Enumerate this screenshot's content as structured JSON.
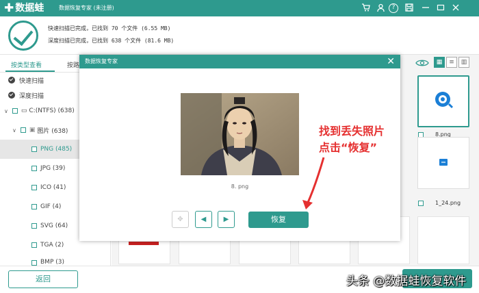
{
  "app": {
    "logo_mark": "✚",
    "name": "数据蛙",
    "subtitle": "数据恢复专家 (未注册)"
  },
  "titlebar_icons": [
    "cart-icon",
    "user-icon",
    "help-icon",
    "save-icon",
    "minimize-icon",
    "restore-icon",
    "close-icon"
  ],
  "status": {
    "quick": "快速扫描已完成，已找到 70 个文件 (6.55 MB)",
    "deep": "深度扫描已完成，已找到 638 个文件 (81.6 MB)"
  },
  "tabs": {
    "by_type": "按类型查看",
    "by_path": "按路"
  },
  "scan": {
    "quick": "快速扫描",
    "deep": "深度扫描"
  },
  "tree": {
    "drive": "C:(NTFS) (638)",
    "pictures": "图片 (638)",
    "items": [
      "PNG (485)",
      "JPG (39)",
      "ICO (41)",
      "GIF (4)",
      "SVG (64)",
      "TGA (2)",
      "BMP (3)"
    ]
  },
  "files": {
    "f1": "8.png",
    "f2": "1_24.png"
  },
  "bottom": {
    "back": "返回"
  },
  "modal": {
    "title": "数据恢复专家",
    "filename": "8. png",
    "recover": "恢复"
  },
  "annotation": {
    "line1": "找到丢失照片",
    "line2": "点击“恢复”"
  },
  "watermark": "头条 @数据蛙恢复软件",
  "colors": {
    "accent": "#2e9a8e",
    "annotation": "#e53030"
  }
}
